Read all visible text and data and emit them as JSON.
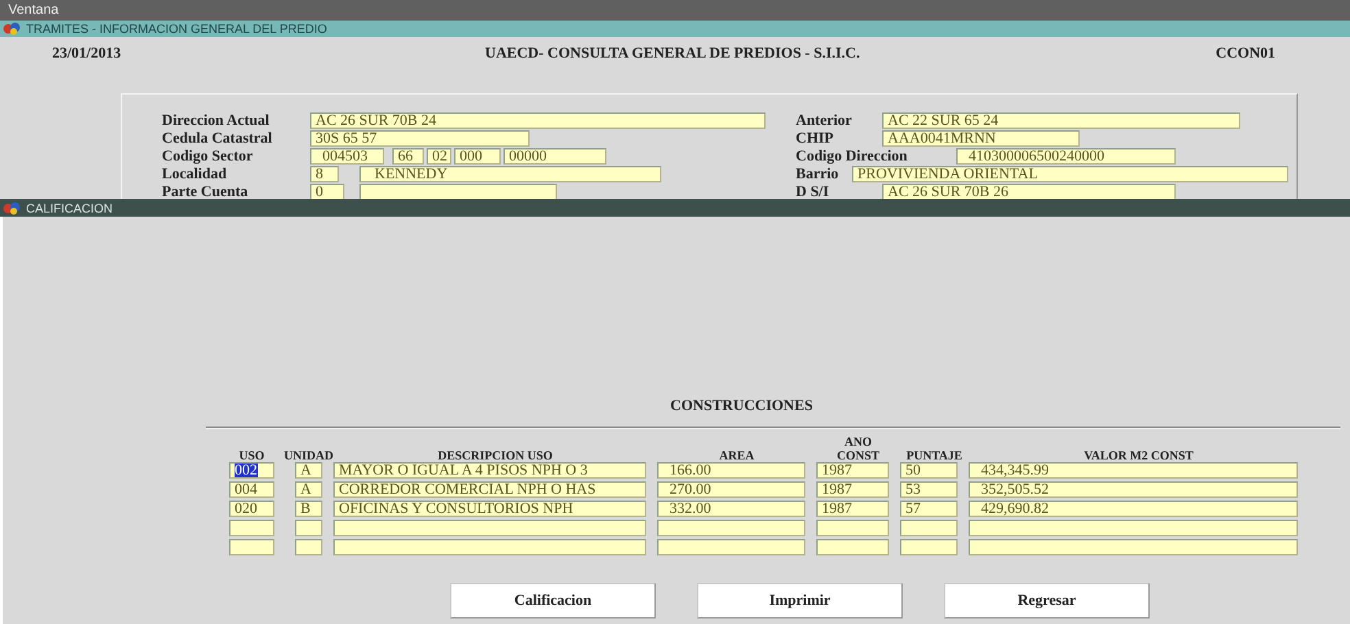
{
  "menu_bar": {
    "items": [
      "Ventana"
    ]
  },
  "main_window": {
    "title": "TRAMITES - INFORMACION GENERAL DEL PREDIO",
    "date": "23/01/2013",
    "heading": "UAECD- CONSULTA GENERAL DE PREDIOS - S.I.I.C.",
    "code": "CCON01",
    "left_fields": [
      {
        "label": "Direccion Actual",
        "values": [
          "AC 26 SUR 70B 24"
        ]
      },
      {
        "label": "Cedula Catastral",
        "values": [
          "30S 65 57"
        ]
      },
      {
        "label": "Codigo Sector",
        "values": [
          "004503",
          "66",
          "02",
          "000",
          "00000"
        ]
      },
      {
        "label": "Localidad",
        "values": [
          "8",
          "KENNEDY"
        ]
      },
      {
        "label": "Parte Cuenta",
        "values": [
          "0"
        ]
      }
    ],
    "right_fields": [
      {
        "label": "Anterior",
        "values": [
          "AC 22 SUR 65 24"
        ]
      },
      {
        "label": "CHIP",
        "values": [
          "AAA0041MRNN"
        ]
      },
      {
        "label": "Codigo Direccion",
        "values": [
          "410300006500240000"
        ]
      },
      {
        "label": "Barrio",
        "values": [
          "PROVIVIENDA ORIENTAL"
        ]
      },
      {
        "label": "D S/I",
        "values": [
          "AC 26 SUR 70B 26"
        ]
      }
    ]
  },
  "calificacion_window": {
    "title": "CALIFICACION",
    "section_title": "CONSTRUCCIONES",
    "table": {
      "columns": [
        "USO",
        "UNIDAD",
        "DESCRIPCION USO",
        "AREA",
        "ANO\nCONST",
        "PUNTAJE",
        "VALOR M2 CONST"
      ],
      "rows": [
        {
          "cells": [
            "002",
            "A",
            "MAYOR O IGUAL A 4 PISOS NPH O 3",
            "166.00",
            "1987",
            "50",
            "434,345.99"
          ],
          "selected": true
        },
        {
          "cells": [
            "004",
            "A",
            "CORREDOR COMERCIAL NPH O HAS",
            "270.00",
            "1987",
            "53",
            "352,505.52"
          ],
          "selected": false
        },
        {
          "cells": [
            "020",
            "B",
            "OFICINAS Y CONSULTORIOS NPH",
            "332.00",
            "1987",
            "57",
            "429,690.82"
          ],
          "selected": false
        },
        {
          "cells": [
            null,
            null,
            null,
            null,
            null,
            null,
            null
          ],
          "selected": false
        },
        {
          "cells": [
            null,
            null,
            null,
            null,
            null,
            null,
            null
          ],
          "selected": false
        }
      ]
    },
    "buttons": [
      "Calificacion",
      "Imprimir",
      "Regresar"
    ]
  }
}
